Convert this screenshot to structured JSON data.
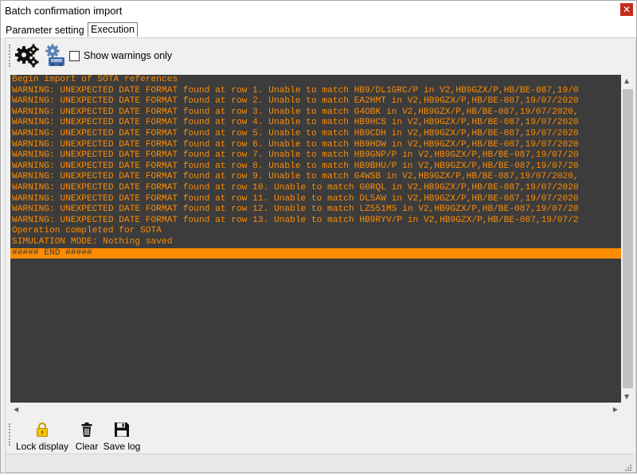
{
  "window": {
    "title": "Batch confirmation import",
    "close_symbol": "✕"
  },
  "tabs": [
    {
      "label": "Parameter setting",
      "active": false
    },
    {
      "label": "Execution",
      "active": true
    }
  ],
  "toolbar": {
    "run_icon": "gears-icon",
    "simulate_icon": "simulation-gears-icon",
    "show_warnings_label": "Show warnings only",
    "show_warnings_checked": false
  },
  "log": {
    "lines": [
      "Begin import of SOTA references",
      "WARNING: UNEXPECTED DATE FORMAT found at row 1. Unable to match HB9/DL1GRC/P in V2,HB9GZX/P,HB/BE-087,19/0",
      "WARNING: UNEXPECTED DATE FORMAT found at row 2. Unable to match EA2HMT in V2,HB9GZX/P,HB/BE-087,19/07/2020",
      "WARNING: UNEXPECTED DATE FORMAT found at row 3. Unable to match G4OBK in V2,HB9GZX/P,HB/BE-087,19/07/2020,",
      "WARNING: UNEXPECTED DATE FORMAT found at row 4. Unable to match HB9HCS in V2,HB9GZX/P,HB/BE-087,19/07/2020",
      "WARNING: UNEXPECTED DATE FORMAT found at row 5. Unable to match HB9CDH in V2,HB9GZX/P,HB/BE-087,19/07/2020",
      "WARNING: UNEXPECTED DATE FORMAT found at row 6. Unable to match HB9HDW in V2,HB9GZX/P,HB/BE-087,19/07/2020",
      "WARNING: UNEXPECTED DATE FORMAT found at row 7. Unable to match HB9GNP/P in V2,HB9GZX/P,HB/BE-087,19/07/20",
      "WARNING: UNEXPECTED DATE FORMAT found at row 8. Unable to match HB9BHU/P in V2,HB9GZX/P,HB/BE-087,19/07/20",
      "WARNING: UNEXPECTED DATE FORMAT found at row 9. Unable to match G4WSB in V2,HB9GZX/P,HB/BE-087,19/07/2020,",
      "WARNING: UNEXPECTED DATE FORMAT found at row 10. Unable to match G0RQL in V2,HB9GZX/P,HB/BE-087,19/07/2020",
      "WARNING: UNEXPECTED DATE FORMAT found at row 11. Unable to match DL5AW in V2,HB9GZX/P,HB/BE-087,19/07/2020",
      "WARNING: UNEXPECTED DATE FORMAT found at row 12. Unable to match LZ551MS in V2,HB9GZX/P,HB/BE-087,19/07/20",
      "WARNING: UNEXPECTED DATE FORMAT found at row 13. Unable to match HB9RYV/P in V2,HB9GZX/P,HB/BE-087,19/07/2",
      "Operation completed for SOTA",
      "SIMULATION MODE: Nothing saved"
    ],
    "end_line": "##### END #####",
    "text_color": "#ff8c00",
    "background_color": "#3c3c3c"
  },
  "actions": [
    {
      "label": "Lock display",
      "icon": "lock-icon"
    },
    {
      "label": "Clear",
      "icon": "trash-icon"
    },
    {
      "label": "Save log",
      "icon": "floppy-disk-icon"
    }
  ]
}
